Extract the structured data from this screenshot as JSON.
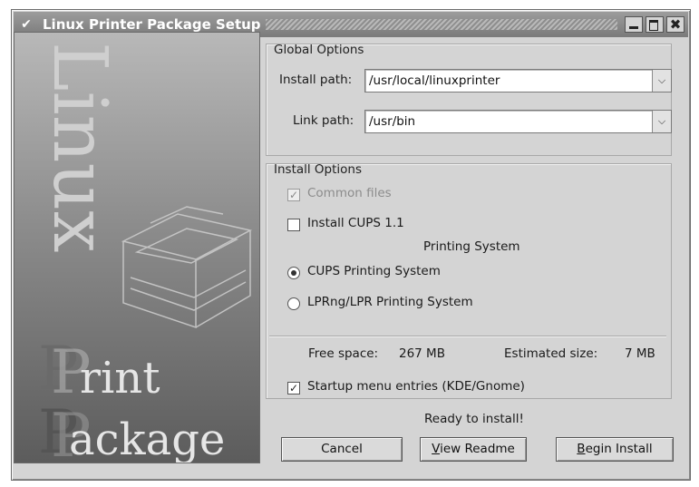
{
  "window": {
    "title": "Linux Printer Package Setup"
  },
  "banner": {
    "vertical_text": "Linux",
    "logo_line1": "rint",
    "logo_line2": "ackage",
    "logo_letter1": "P",
    "logo_letter2": "P"
  },
  "global_options": {
    "title": "Global Options",
    "install_path_label": "Install path:",
    "install_path_value": "/usr/local/linuxprinter",
    "link_path_label": "Link path:",
    "link_path_value": "/usr/bin"
  },
  "install_options": {
    "title": "Install Options",
    "common_files": "Common files",
    "common_files_checked": true,
    "install_cups": "Install CUPS 1.1",
    "install_cups_checked": false,
    "printing_system_label": "Printing System",
    "radio_cups": "CUPS Printing System",
    "radio_lprng": "LPRng/LPR Printing System",
    "selected": "CUPS Printing System",
    "free_space_label": "Free space:",
    "free_space_value": "267 MB",
    "estimated_size_label": "Estimated size:",
    "estimated_size_value": "7 MB",
    "startup_menu": "Startup menu entries (KDE/Gnome)",
    "startup_menu_checked": true
  },
  "status": "Ready to install!",
  "buttons": {
    "cancel": "Cancel",
    "view_readme_mn": "V",
    "view_readme_rest": "iew Readme",
    "begin_install_mn": "B",
    "begin_install_rest": "egin Install"
  },
  "colors": {
    "titlebar": "#8a8a8a",
    "window_bg": "#d4d4d4"
  }
}
